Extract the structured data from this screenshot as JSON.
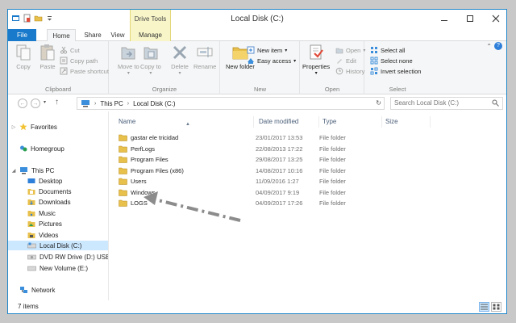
{
  "window": {
    "title": "Local Disk (C:)",
    "context_tab_group": "Drive Tools"
  },
  "tabs": [
    {
      "label": "File"
    },
    {
      "label": "Home"
    },
    {
      "label": "Share"
    },
    {
      "label": "View"
    },
    {
      "label": "Manage"
    }
  ],
  "ribbon": {
    "clipboard": {
      "label": "Clipboard",
      "copy": "Copy",
      "paste": "Paste",
      "cut": "Cut",
      "copy_path": "Copy path",
      "paste_shortcut": "Paste shortcut"
    },
    "organize": {
      "label": "Organize",
      "move_to": "Move to",
      "copy_to": "Copy to",
      "delete": "Delete",
      "rename": "Rename"
    },
    "new": {
      "label": "New",
      "new_folder": "New folder",
      "new_item": "New item",
      "easy_access": "Easy access"
    },
    "open": {
      "label": "Open",
      "properties": "Properties",
      "open": "Open",
      "edit": "Edit",
      "history": "History"
    },
    "select": {
      "label": "Select",
      "select_all": "Select all",
      "select_none": "Select none",
      "invert_selection": "Invert selection"
    }
  },
  "address": {
    "crumb1": "This PC",
    "crumb2": "Local Disk (C:)",
    "search_placeholder": "Search Local Disk (C:)"
  },
  "nav": {
    "favorites": "Favorites",
    "homegroup": "Homegroup",
    "this_pc": "This PC",
    "desktop": "Desktop",
    "documents": "Documents",
    "downloads": "Downloads",
    "music": "Music",
    "pictures": "Pictures",
    "videos": "Videos",
    "local_disk": "Local Disk (C:)",
    "dvd": "DVD RW Drive (D:) USB A",
    "new_volume": "New Volume (E:)",
    "network": "Network"
  },
  "columns": {
    "name": "Name",
    "date": "Date modified",
    "type": "Type",
    "size": "Size"
  },
  "files": [
    {
      "name": "gastar ele tricidad",
      "date": "23/01/2017 13:53",
      "type": "File folder"
    },
    {
      "name": "PerfLogs",
      "date": "22/08/2013 17:22",
      "type": "File folder"
    },
    {
      "name": "Program Files",
      "date": "29/08/2017 13:25",
      "type": "File folder"
    },
    {
      "name": "Program Files (x86)",
      "date": "14/08/2017 10:16",
      "type": "File folder"
    },
    {
      "name": "Users",
      "date": "11/09/2016 1:27",
      "type": "File folder"
    },
    {
      "name": "Windows",
      "date": "04/09/2017 9:19",
      "type": "File folder"
    },
    {
      "name": "LOGS",
      "date": "04/09/2017 17:26",
      "type": "File folder"
    }
  ],
  "status": {
    "item_count": "7 items"
  },
  "colors": {
    "accent": "#1979ca",
    "folder": "#e8c04c",
    "selection": "#cce8ff",
    "annotation_arrow": "#8c8c8c"
  }
}
